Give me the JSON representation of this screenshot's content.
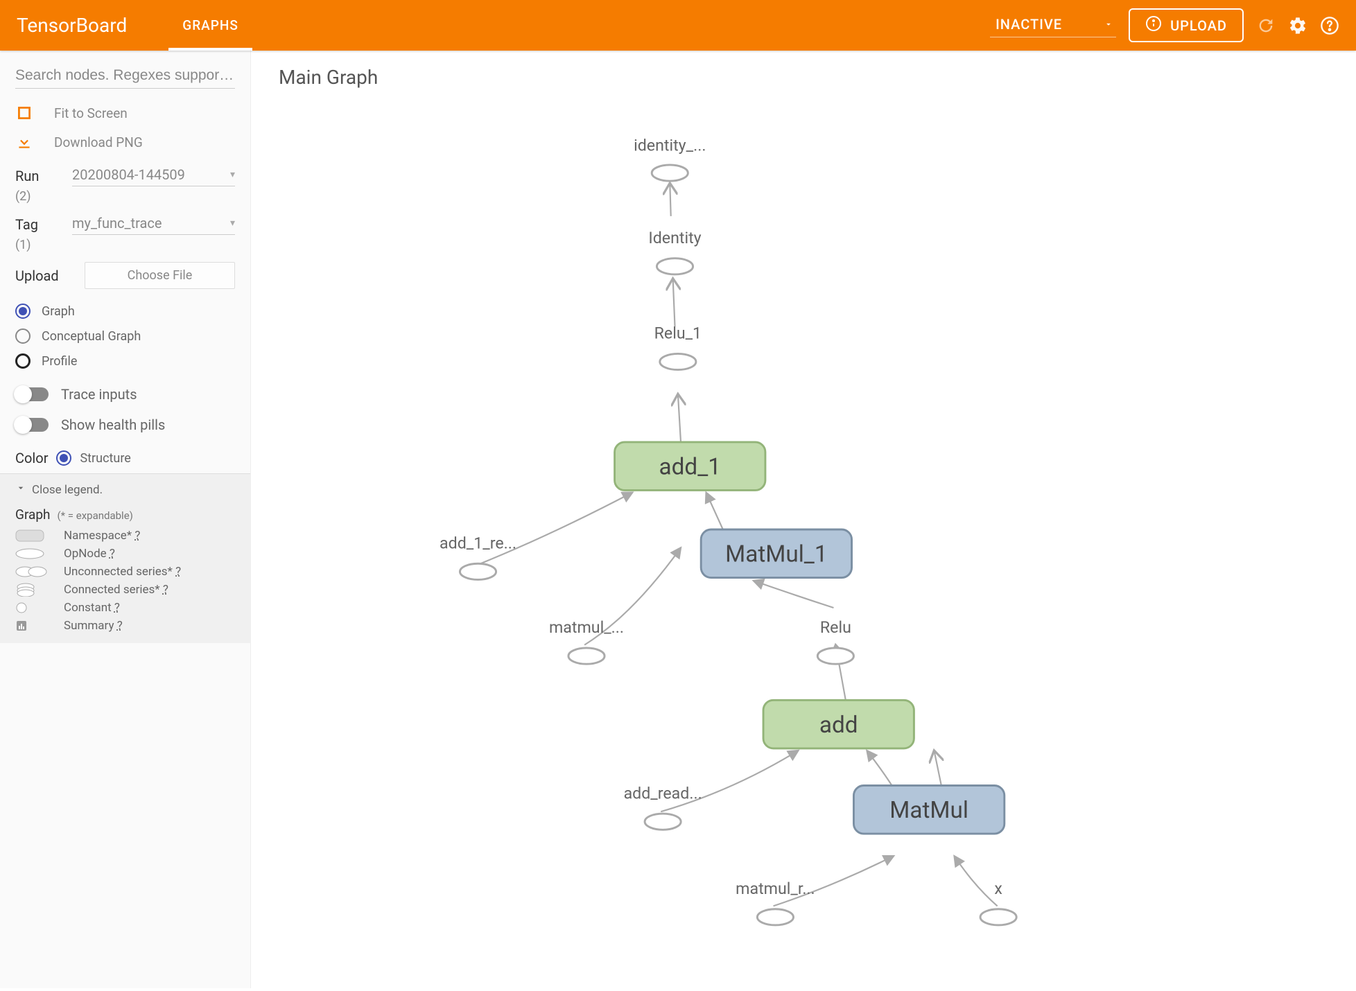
{
  "header": {
    "logo": "TensorBoard",
    "tabs": {
      "graphs": "GRAPHS"
    },
    "inactive_label": "INACTIVE",
    "upload_label": "UPLOAD"
  },
  "sidebar": {
    "search_placeholder": "Search nodes. Regexes suppor…",
    "fit_label": "Fit to Screen",
    "download_label": "Download PNG",
    "run": {
      "label": "Run",
      "count": "(2)",
      "value": "20200804-144509"
    },
    "tag": {
      "label": "Tag",
      "count": "(1)",
      "value": "my_func_trace"
    },
    "upload": {
      "label": "Upload",
      "button": "Choose File"
    },
    "graph_type": {
      "graph": "Graph",
      "conceptual": "Conceptual Graph",
      "profile": "Profile"
    },
    "trace_inputs": "Trace inputs",
    "health_pills": "Show health pills",
    "color": {
      "label": "Color",
      "value": "Structure"
    },
    "legend": {
      "toggle": "Close legend.",
      "title": "Graph",
      "note": "(* = expandable)",
      "items": {
        "namespace": "Namespace* ",
        "opnode": "OpNode ",
        "unconnected": "Unconnected series* ",
        "connected": "Connected series* ",
        "constant": "Constant ",
        "summary": "Summary "
      },
      "q": "?"
    }
  },
  "canvas": {
    "title": "Main Graph",
    "nodes": {
      "identity_trunc": "identity_...",
      "identity": "Identity",
      "relu_1": "Relu_1",
      "add_1": "add_1",
      "add_1_re": "add_1_re...",
      "matmul_1": "MatMul_1",
      "matmul_trunc": "matmul_...",
      "relu": "Relu",
      "add": "add",
      "add_read": "add_read...",
      "matmul": "MatMul",
      "matmul_r": "matmul_r...",
      "x": "x"
    }
  }
}
